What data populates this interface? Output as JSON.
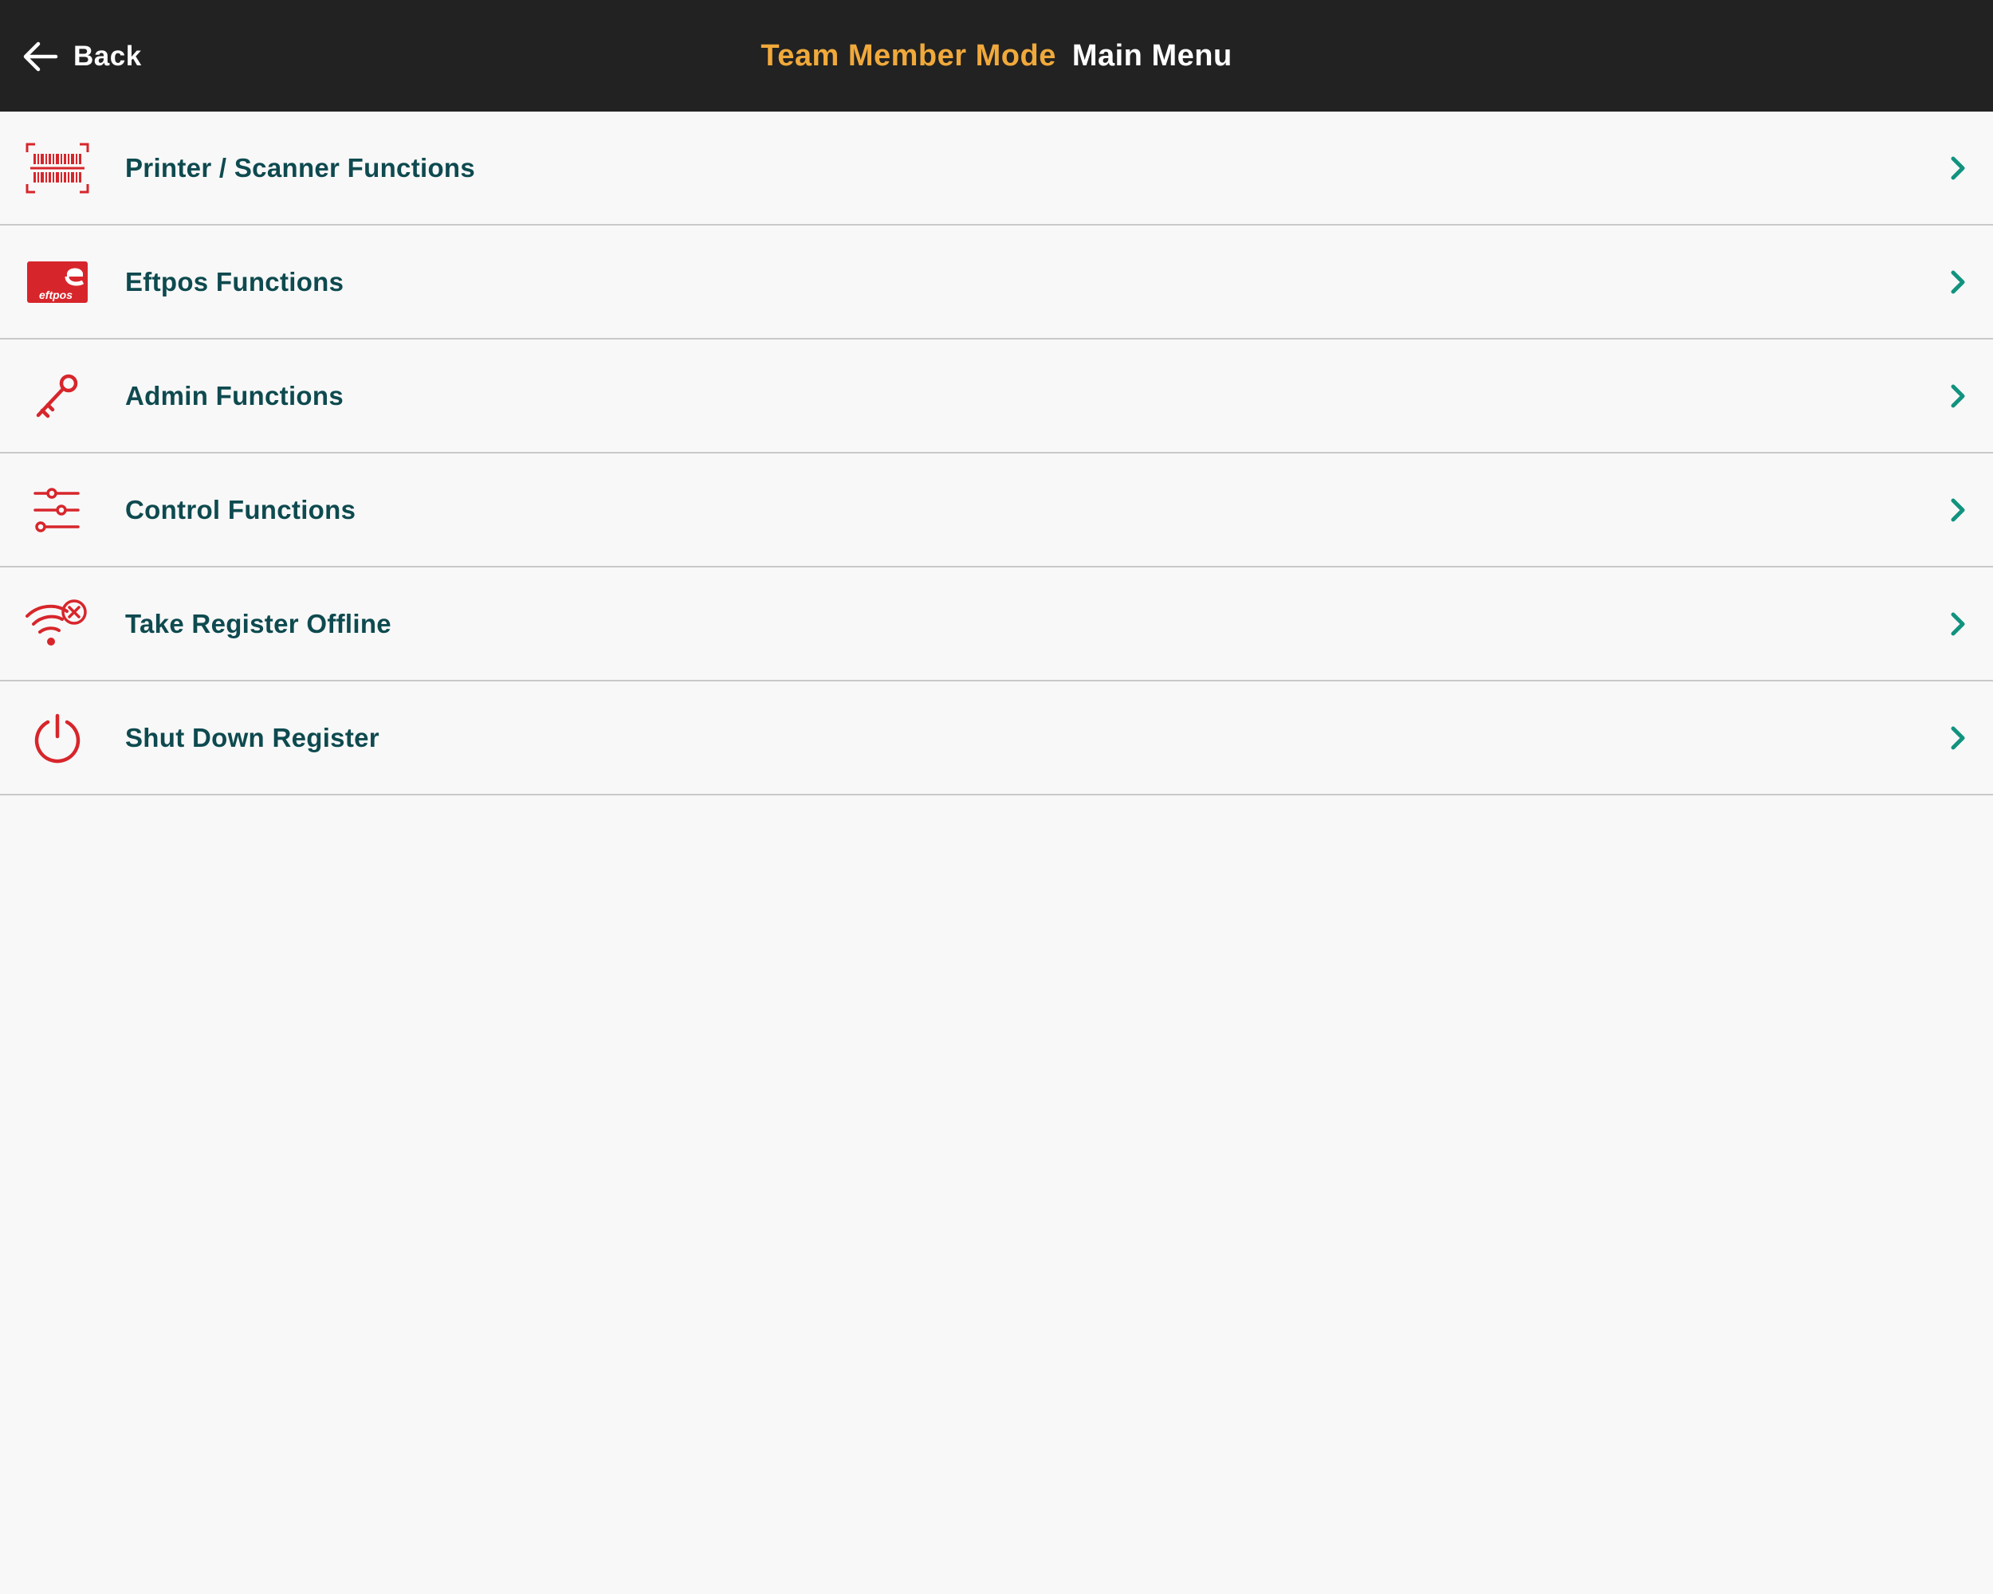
{
  "header": {
    "back_label": "Back",
    "mode_label": "Team Member Mode",
    "title": "Main Menu"
  },
  "menu": {
    "items": [
      {
        "label": "Printer / Scanner Functions",
        "icon": "barcode-scanner-icon"
      },
      {
        "label": "Eftpos Functions",
        "icon": "eftpos-card-icon",
        "icon_text": "eftpos"
      },
      {
        "label": "Admin Functions",
        "icon": "key-icon"
      },
      {
        "label": "Control Functions",
        "icon": "sliders-icon"
      },
      {
        "label": "Take Register Offline",
        "icon": "wifi-off-icon"
      },
      {
        "label": "Shut Down Register",
        "icon": "power-icon"
      }
    ]
  },
  "colors": {
    "header_bg": "#222222",
    "mode_accent": "#f0a93b",
    "label_text": "#0e4a4f",
    "icon_red": "#d7262b",
    "chevron_teal": "#11937f",
    "background": "#f8f8f8",
    "divider": "#c9c9c9"
  }
}
